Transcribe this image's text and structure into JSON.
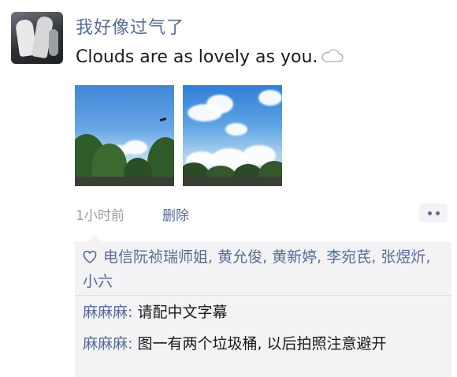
{
  "post": {
    "author": "我好像过气了",
    "caption": "Clouds are as lovely as you.",
    "caption_emoji": "cloud-icon"
  },
  "photos": [
    {
      "label": "photo-1"
    },
    {
      "label": "photo-2"
    }
  ],
  "meta": {
    "time": "1小时前",
    "delete": "删除"
  },
  "likes": {
    "icon": "heart-icon",
    "names": "电信阮祯瑞师姐, 黄允俊, 黄新婷, 李宛芪, 张煜炘, 小六"
  },
  "comments": [
    {
      "name": "麻麻麻",
      "sep": ": ",
      "text": "请配中文字幕"
    },
    {
      "name": "麻麻麻",
      "sep": ": ",
      "text": "图一有两个垃圾桶, 以后拍照注意避开"
    }
  ],
  "colors": {
    "link": "#576b95",
    "panel": "#f3f3f5",
    "meta": "#9b9b9b"
  }
}
